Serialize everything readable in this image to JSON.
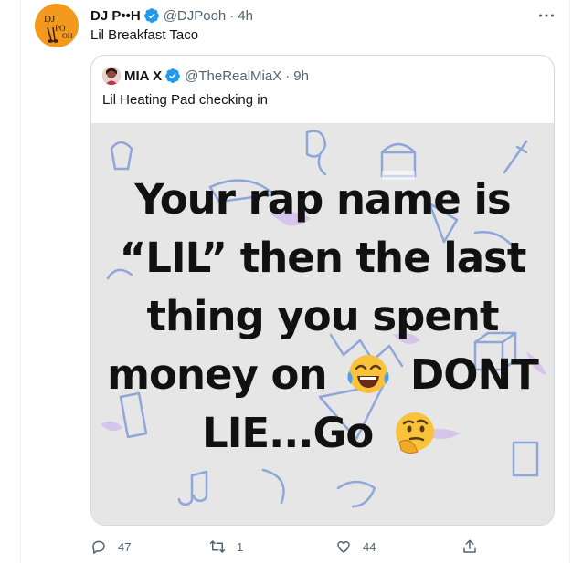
{
  "tweet": {
    "author_name": "DJ P••H",
    "handle": "@DJPooh",
    "separator": "·",
    "time": "4h",
    "text": "Lil Breakfast Taco",
    "avatar_text": "DJ POOH"
  },
  "quote": {
    "author_name": "MIA X",
    "handle": "@TheRealMiaX",
    "separator": "·",
    "time": "9h",
    "text": "Lil Heating Pad checking in",
    "meme": {
      "line1": "Your rap name is",
      "line2": "“LIL” then the last",
      "line3": "thing you spent",
      "line4a": "money on",
      "line4b": "DONT",
      "line5": "LIE...Go",
      "emoji1": "laughing-crying-emoji",
      "emoji2": "thinking-emoji"
    }
  },
  "actions": {
    "reply_count": "47",
    "retweet_count": "1",
    "like_count": "44",
    "reply_icon": "reply-icon",
    "retweet_icon": "retweet-icon",
    "like_icon": "heart-icon",
    "share_icon": "share-icon"
  },
  "colors": {
    "verified": "#1d9bf0",
    "secondary_text": "#536471",
    "avatar_bg": "#f39a1e",
    "meme_bg": "#e6e6e6"
  }
}
